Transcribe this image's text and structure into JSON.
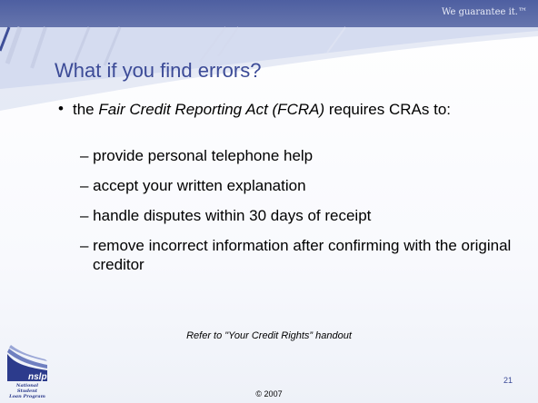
{
  "header": {
    "tagline": "We guarantee it.™"
  },
  "slide": {
    "title": "What if you find errors?",
    "bullet": {
      "text_before": "the ",
      "text_italic": "Fair Credit Reporting Act (FCRA)",
      "text_after": " requires CRAs to:"
    },
    "sub_items": [
      "– provide personal telephone help",
      "– accept your written explanation",
      "– handle disputes within 30 days of receipt",
      "– remove incorrect information after confirming with the original creditor"
    ],
    "footnote": "Refer to \"Your Credit Rights” handout",
    "page_number": "21",
    "copyright": "© 2007"
  },
  "logo": {
    "mark": "nslp",
    "caption_lines": [
      "National Student",
      "Loan Program"
    ]
  },
  "colors": {
    "header": "#4e5fa1",
    "title": "#3c4b97",
    "logo": "#2c3b8c"
  }
}
